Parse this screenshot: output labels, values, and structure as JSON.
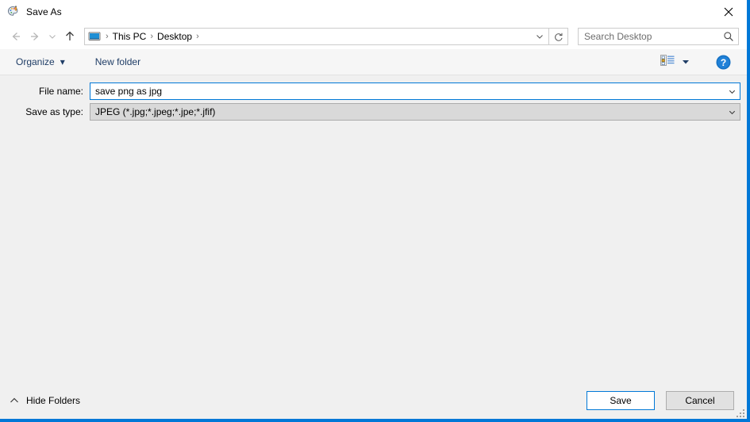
{
  "window": {
    "title": "Save As",
    "icon": "paint-palette-icon",
    "close_label": "✕",
    "accent_color": "#0078d7",
    "body_color": "#f0f0f0"
  },
  "navigation": {
    "back_icon": "arrow-left-icon",
    "forward_icon": "arrow-right-icon",
    "recent_icon": "chevron-down-icon",
    "up_icon": "arrow-up-icon",
    "breadcrumb_icon": "monitor-icon",
    "breadcrumbs": [
      {
        "label": "This PC"
      },
      {
        "label": "Desktop"
      }
    ],
    "separator": "›",
    "address_dropdown_icon": "chevron-down-icon",
    "refresh_icon": "refresh-icon"
  },
  "search": {
    "placeholder": "Search Desktop",
    "icon": "search-icon"
  },
  "toolbar": {
    "organize_label": "Organize",
    "organize_caret": "▾",
    "new_folder_label": "New folder",
    "view_icon": "list-view-icon",
    "view_caret": "▾",
    "help_icon": "help-icon",
    "help_label": "?"
  },
  "form": {
    "file_name": {
      "label": "File name:",
      "value": "save png as jpg",
      "chevron_icon": "chevron-down-icon"
    },
    "save_as_type": {
      "label": "Save as type:",
      "value": "JPEG (*.jpg;*.jpeg;*.jpe;*.jfif)",
      "chevron_icon": "chevron-down-icon"
    }
  },
  "footer": {
    "hide_folders_label": "Hide Folders",
    "hide_folders_icon": "chevron-up-icon",
    "save_label": "Save",
    "cancel_label": "Cancel",
    "resize_grip_icon": "resize-grip-icon"
  }
}
